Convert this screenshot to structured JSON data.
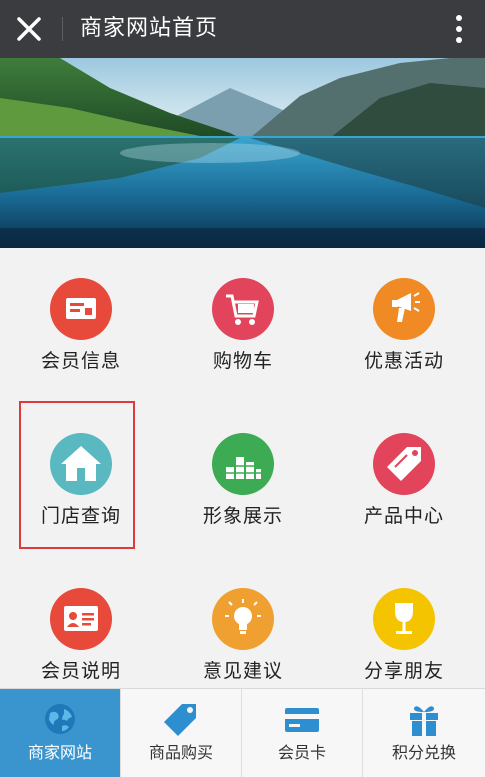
{
  "header": {
    "title": "商家网站首页",
    "close_icon": "close-icon",
    "more_icon": "more-vertical-icon"
  },
  "banner": {
    "description_icon": "lake-mountain-landscape"
  },
  "grid": {
    "items": [
      {
        "label": "会员信息",
        "icon": "member-card-icon",
        "color": "#e74a3b"
      },
      {
        "label": "购物车",
        "icon": "shopping-cart-icon",
        "color": "#e2445c"
      },
      {
        "label": "优惠活动",
        "icon": "promotion-megaphone-icon",
        "color": "#f08a24"
      },
      {
        "label": "门店查询",
        "icon": "store-house-icon",
        "color": "#5ab9c0"
      },
      {
        "label": "形象展示",
        "icon": "bar-blocks-icon",
        "color": "#3daa54"
      },
      {
        "label": "产品中心",
        "icon": "tag-icon",
        "color": "#e2445c"
      },
      {
        "label": "会员说明",
        "icon": "id-card-icon",
        "color": "#e74a3b"
      },
      {
        "label": "意见建议",
        "icon": "lightbulb-icon",
        "color": "#f0a030"
      },
      {
        "label": "分享朋友",
        "icon": "wine-glass-icon",
        "color": "#f5c400"
      }
    ]
  },
  "tabbar": {
    "items": [
      {
        "label": "商家网站",
        "icon": "globe-icon",
        "active": true
      },
      {
        "label": "商品购买",
        "icon": "price-tag-icon",
        "active": false
      },
      {
        "label": "会员卡",
        "icon": "credit-card-icon",
        "active": false
      },
      {
        "label": "积分兑换",
        "icon": "gift-icon",
        "active": false
      }
    ]
  },
  "colors": {
    "topbar": "#3b3c40",
    "tab_active": "#3a95cf",
    "tab_icon": "#2d8fcf",
    "highlight": "#e0393b"
  }
}
